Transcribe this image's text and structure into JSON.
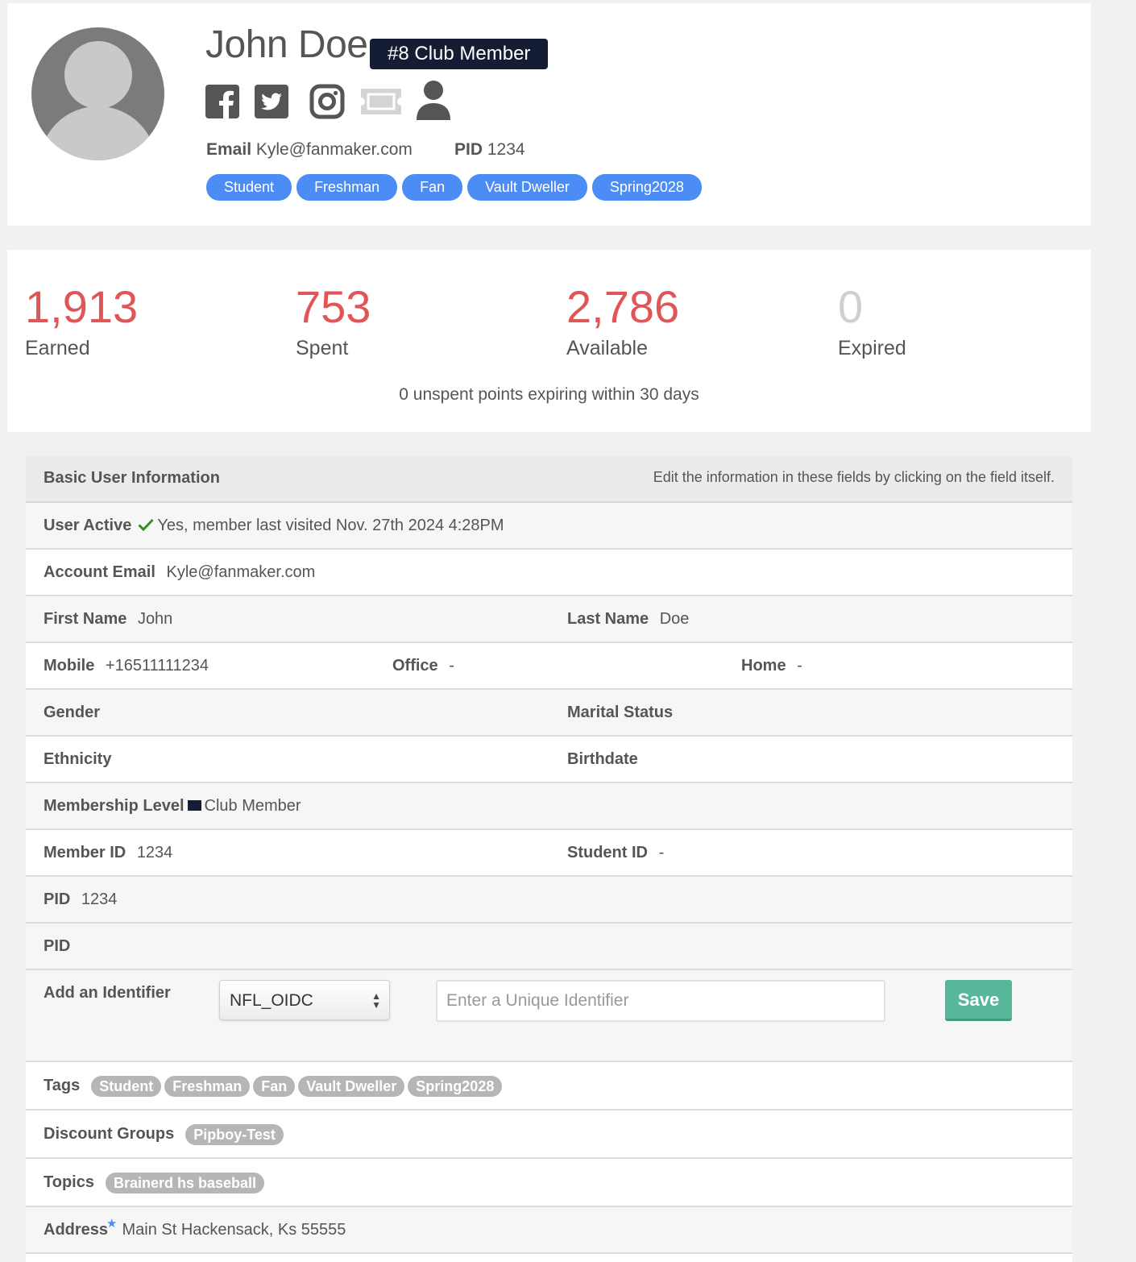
{
  "profile": {
    "name": "John Doe",
    "rank_badge": "#8 Club Member",
    "social_icons": [
      "facebook-icon",
      "twitter-icon",
      "instagram-icon",
      "ticket-icon",
      "user-icon"
    ],
    "email_label": "Email",
    "email_value": "Kyle@fanmaker.com",
    "pid_label": "PID",
    "pid_value": "1234",
    "pills": [
      "Student",
      "Freshman",
      "Fan",
      "Vault Dweller",
      "Spring2028"
    ]
  },
  "points": {
    "stats": [
      {
        "value": "1,913",
        "label": "Earned"
      },
      {
        "value": "753",
        "label": "Spent"
      },
      {
        "value": "2,786",
        "label": "Available"
      },
      {
        "value": "0",
        "label": "Expired"
      }
    ],
    "expiring_note": "0 unspent points expiring within 30 days"
  },
  "info": {
    "title": "Basic User Information",
    "hint": "Edit the information in these fields by clicking on the field itself.",
    "user_active_label": "User Active",
    "user_active_value": "Yes, member last visited Nov. 27th 2024 4:28PM",
    "account_email_label": "Account Email",
    "account_email_value": "Kyle@fanmaker.com",
    "first_name_label": "First Name",
    "first_name_value": "John",
    "last_name_label": "Last Name",
    "last_name_value": "Doe",
    "mobile_label": "Mobile",
    "mobile_value": "+16511111234",
    "office_label": "Office",
    "office_value": "-",
    "home_label": "Home",
    "home_value": "-",
    "gender_label": "Gender",
    "marital_label": "Marital Status",
    "ethnicity_label": "Ethnicity",
    "birthdate_label": "Birthdate",
    "membership_label": "Membership Level",
    "membership_value": "Club Member",
    "membership_color": "#151d35",
    "member_id_label": "Member ID",
    "member_id_value": "1234",
    "student_id_label": "Student ID",
    "student_id_value": "-",
    "pid_label": "PID",
    "pid_value": "1234",
    "pid2_label": "PID",
    "identifier_label": "Add an Identifier",
    "identifier_select": "NFL_OIDC",
    "identifier_placeholder": "Enter a Unique Identifier",
    "save_label": "Save",
    "tags_label": "Tags",
    "tags": [
      "Student",
      "Freshman",
      "Fan",
      "Vault Dweller",
      "Spring2028"
    ],
    "discount_label": "Discount Groups",
    "discount_groups": [
      "Pipboy-Test"
    ],
    "topics_label": "Topics",
    "topics": [
      "Brainerd hs baseball"
    ],
    "address_label": "Address",
    "address_value": "Main St Hackensack, Ks 55555"
  },
  "colors": {
    "accent_blue": "#4c8df5",
    "stat_red": "#e05555",
    "badge_navy": "#151d35",
    "save_green": "#56b79a",
    "active_check": "#3c8a1e"
  }
}
